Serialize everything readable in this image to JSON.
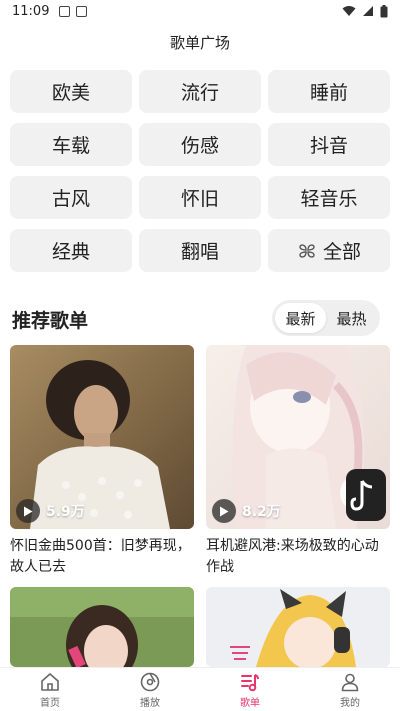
{
  "status_bar": {
    "time": "11:09"
  },
  "header": {
    "title": "歌单广场"
  },
  "categories": [
    "欧美",
    "流行",
    "睡前",
    "车载",
    "伤感",
    "抖音",
    "古风",
    "怀旧",
    "轻音乐",
    "经典",
    "翻唱",
    "全部"
  ],
  "section": {
    "title": "推荐歌单",
    "sort_options": [
      "最新",
      "最热"
    ],
    "active_sort": "最新"
  },
  "playlists": [
    {
      "title": "怀旧金曲500首：旧梦再现，故人已去",
      "play_count": "5.9万"
    },
    {
      "title": "耳机避风港:来场极致的心动作战",
      "play_count": "8.2万"
    },
    {
      "title": "",
      "play_count": ""
    },
    {
      "title": "",
      "play_count": ""
    }
  ],
  "tabs": [
    {
      "label": "首页",
      "icon": "home-icon"
    },
    {
      "label": "播放",
      "icon": "disc-icon"
    },
    {
      "label": "歌单",
      "icon": "playlist-icon"
    },
    {
      "label": "我的",
      "icon": "user-icon"
    }
  ],
  "active_tab": "歌单",
  "colors": {
    "accent": "#e8366b",
    "chip_bg": "#f1f1f1",
    "tab_default": "#666666"
  }
}
